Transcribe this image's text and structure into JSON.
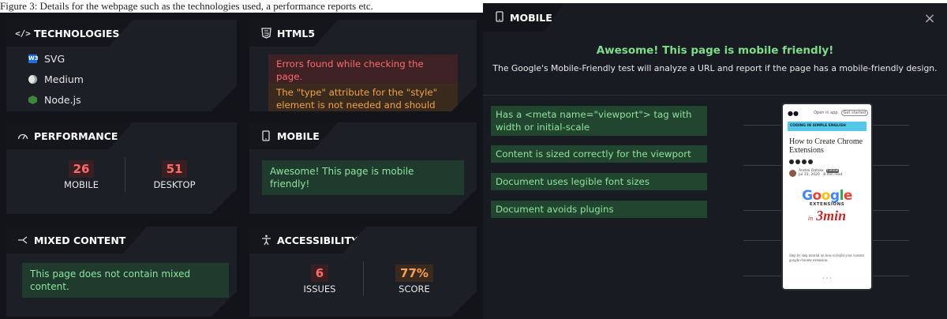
{
  "left": {
    "caption": "Figure 3: Details for the webpage such as the technologies used, a performance reports etc.",
    "technologies": {
      "title": "TECHNOLOGIES",
      "items": [
        {
          "label": "SVG",
          "icon": "w3c-icon",
          "color": "#1e6fd9"
        },
        {
          "label": "Medium",
          "icon": "medium-icon",
          "color": "#dddddd"
        },
        {
          "label": "Node.js",
          "icon": "nodejs-icon",
          "color": "#3c873a"
        }
      ]
    },
    "html5": {
      "title": "HTML5",
      "error1": "Errors found while checking the page.",
      "error2": "The \"type\" attribute for the \"style\" element is not needed and should be omitted."
    },
    "performance": {
      "title": "PERFORMANCE",
      "mobile_value": "26",
      "mobile_label": "MOBILE",
      "desktop_value": "51",
      "desktop_label": "DESKTOP"
    },
    "mobile": {
      "title": "MOBILE",
      "message": "Awesome! This page is mobile friendly!"
    },
    "mixed": {
      "title": "MIXED CONTENT",
      "message": "This page does not contain mixed content."
    },
    "accessibility": {
      "title": "ACCESSIBILITY",
      "issues_value": "6",
      "issues_label": "ISSUES",
      "score_value": "77%",
      "score_label": "SCORE"
    }
  },
  "right": {
    "header": "MOBILE",
    "close": "×",
    "title": "Awesome! This page is mobile friendly!",
    "description": "The Google's Mobile-Friendly test will analyze a URL and report if the page has a mobile-friendly design.",
    "checks": [
      "Has a <meta name=\"viewport\"> tag with width or initial-scale",
      "Content is sized correctly for the viewport",
      "Document uses legible font sizes",
      "Document avoids plugins"
    ],
    "preview": {
      "logo": "●●",
      "top_link1": "Open in app",
      "top_link2": "Get started",
      "banner": "CODING IN SIMPLE ENGLISH",
      "article_title": "How to Create Chrome Extensions",
      "author": "Andrei Datsko",
      "follow": "Follow",
      "date": "Jul 31, 2020 · 8 min read",
      "logo_text": "Google",
      "logo_sub": "EXTENSIONS",
      "logo_in": "in",
      "logo_min": "3min",
      "summary": "Step by step tutorial on how to build your custom google chrome extension.",
      "dots": "• • •"
    }
  },
  "colors": {
    "accent_green": "#8fe49e",
    "error_red": "#ff6b6b",
    "warn_orange": "#f0a24a",
    "stat_red": "#ff6b6b",
    "stat_orange": "#f5a05a"
  }
}
